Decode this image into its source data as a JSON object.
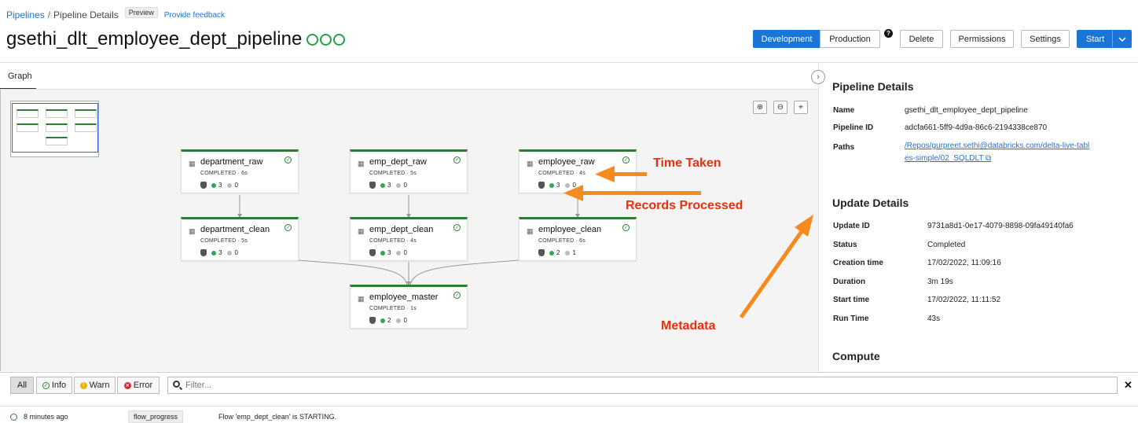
{
  "breadcrumb": {
    "pipelines": "Pipelines",
    "separator": "/",
    "current": "Pipeline Details",
    "badge": "Preview",
    "feedback": "Provide feedback"
  },
  "page_title": "gsethi_dlt_employee_dept_pipeline",
  "toolbar": {
    "development": "Development",
    "production": "Production",
    "help": "?",
    "delete": "Delete",
    "permissions": "Permissions",
    "settings": "Settings",
    "start": "Start"
  },
  "tabs": {
    "graph": "Graph"
  },
  "nodes": [
    {
      "name": "department_raw",
      "status": "COMPLETED · 6s",
      "written": "3",
      "dropped": "0"
    },
    {
      "name": "emp_dept_raw",
      "status": "COMPLETED · 5s",
      "written": "3",
      "dropped": "0"
    },
    {
      "name": "employee_raw",
      "status": "COMPLETED · 4s",
      "written": "3",
      "dropped": "0"
    },
    {
      "name": "department_clean",
      "status": "COMPLETED · 5s",
      "written": "3",
      "dropped": "0"
    },
    {
      "name": "emp_dept_clean",
      "status": "COMPLETED · 4s",
      "written": "3",
      "dropped": "0"
    },
    {
      "name": "employee_clean",
      "status": "COMPLETED · 6s",
      "written": "2",
      "dropped": "1"
    },
    {
      "name": "employee_master",
      "status": "COMPLETED · 1s",
      "written": "2",
      "dropped": "0"
    }
  ],
  "annotations": {
    "time_taken": "Time Taken",
    "records_processed": "Records Processed",
    "metadata": "Metadata"
  },
  "pipeline_details": {
    "title": "Pipeline Details",
    "name_label": "Name",
    "name": "gsethi_dlt_employee_dept_pipeline",
    "id_label": "Pipeline ID",
    "id": "adcfa661-5ff9-4d9a-86c6-2194338ce870",
    "paths_label": "Paths",
    "path": "/Repos/gurpreet.sethi@databricks.com/delta-live-tables-simple/02_SQLDLT"
  },
  "update_details": {
    "title": "Update Details",
    "update_id_label": "Update ID",
    "update_id": "9731a8d1-0e17-4079-8898-09fa49140fa6",
    "status_label": "Status",
    "status": "Completed",
    "creation_label": "Creation time",
    "creation": "17/02/2022, 11:09:16",
    "duration_label": "Duration",
    "duration": "3m 19s",
    "start_label": "Start time",
    "start": "17/02/2022, 11:11:52",
    "run_label": "Run Time",
    "run": "43s"
  },
  "compute": {
    "title": "Compute"
  },
  "filter": {
    "all": "All",
    "info": "Info",
    "warn": "Warn",
    "error": "Error",
    "placeholder": "Filter..."
  },
  "log": {
    "time": "8 minutes ago",
    "tag": "flow_progress",
    "message": "Flow 'emp_dept_clean' is STARTING."
  },
  "colors": {
    "accent": "#1b74d6",
    "success": "#2e7d32",
    "annotation": "#e8300e",
    "arrow": "#f58a1f"
  }
}
